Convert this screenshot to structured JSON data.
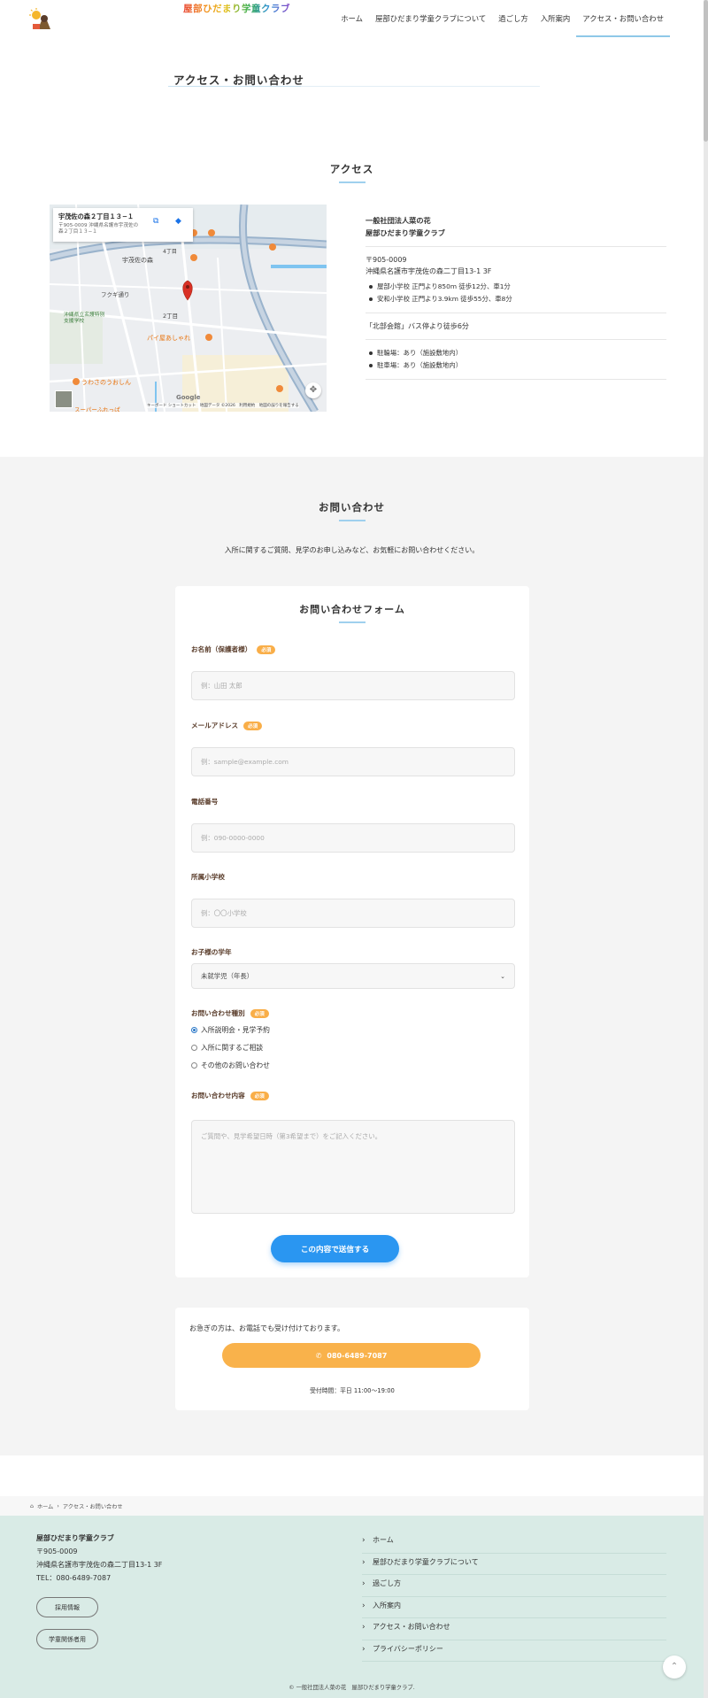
{
  "header": {
    "site_title": "屋部ひだまり学童クラブ",
    "nav": [
      "ホーム",
      "屋部ひだまり学童クラブについて",
      "過ごし方",
      "入所案内",
      "アクセス・お問い合わせ"
    ]
  },
  "page_title": "アクセス・お問い合わせ",
  "access": {
    "heading": "アクセス",
    "map": {
      "place_name": "宇茂佐の森２丁目１３−１",
      "place_address": "〒905-0009 沖縄県名護市宇茂佐の森２丁目１３−１",
      "labels": [
        "宇茂佐の森",
        "フクギ通り",
        "2丁目",
        "4丁目",
        "沖縄県立名護特別支援学校",
        "パイ屋あしゃれ",
        "うわさのうおしん",
        "スーパーふれっぱ"
      ],
      "footer": "キーボード ショートカット　地図データ ©2026　利用規約　地図の誤りを報告する",
      "brand": "Google"
    },
    "org": "一般社団法人菜の花",
    "club": "屋部ひだまり学童クラブ",
    "postal": "〒905-0009",
    "address": "沖縄県名護市宇茂佐の森二丁目13-1 3F",
    "walk": [
      "屋部小学校 正門より850m 徒歩12分、車1分",
      "安和小学校 正門より3.9km 徒歩55分、車8分"
    ],
    "bus": "「北部会館」バス停より徒歩6分",
    "parking": [
      "駐輪場：あり（施設敷地内）",
      "駐車場：あり（施設敷地内）"
    ]
  },
  "contact": {
    "heading": "お問い合わせ",
    "lead": "入所に関するご質問、見学のお申し込みなど、お気軽にお問い合わせください。",
    "form": {
      "title": "お問い合わせフォーム",
      "required_badge": "必須",
      "name_label": "お名前（保護者様）",
      "name_placeholder": "例：山田 太郎",
      "email_label": "メールアドレス",
      "email_placeholder": "例：sample@example.com",
      "phone_label": "電話番号",
      "phone_placeholder": "例：090-0000-0000",
      "school_label": "所属小学校",
      "school_placeholder": "例：〇〇小学校",
      "grade_label": "お子様の学年",
      "grade_value": "未就学児（年長）",
      "type_label": "お問い合わせ種別",
      "type_options": [
        "入所説明会・見学予約",
        "入所に関するご相談",
        "その他のお問い合わせ"
      ],
      "type_selected": 0,
      "message_label": "お問い合わせ内容",
      "message_placeholder": "ご質問や、見学希望日時（第3希望まで）をご記入ください。",
      "submit": "この内容で送信する"
    },
    "tel": {
      "text": "お急ぎの方は、お電話でも受け付けております。",
      "number": "080-6489-7087",
      "hours": "受付時間：平日 11:00〜19:00"
    }
  },
  "breadcrumb": [
    "ホーム",
    "アクセス・お問い合わせ"
  ],
  "footer": {
    "name": "屋部ひだまり学童クラブ",
    "postal": "〒905-0009",
    "address": "沖縄県名護市宇茂佐の森二丁目13-1 3F",
    "tel": "TEL：080-6489-7087",
    "buttons": [
      "採用情報",
      "学童関係者用"
    ],
    "nav": [
      "ホーム",
      "屋部ひだまり学童クラブについて",
      "過ごし方",
      "入所案内",
      "アクセス・お問い合わせ",
      "プライバシーポリシー"
    ],
    "copyright": "© 一般社団法人菜の花　屋部ひだまり学童クラブ."
  },
  "colors": {
    "accent": "#2a96f1",
    "tel_button": "#f9b24b",
    "footer_bg": "#d9ebe6",
    "required": "#f9ae48"
  }
}
